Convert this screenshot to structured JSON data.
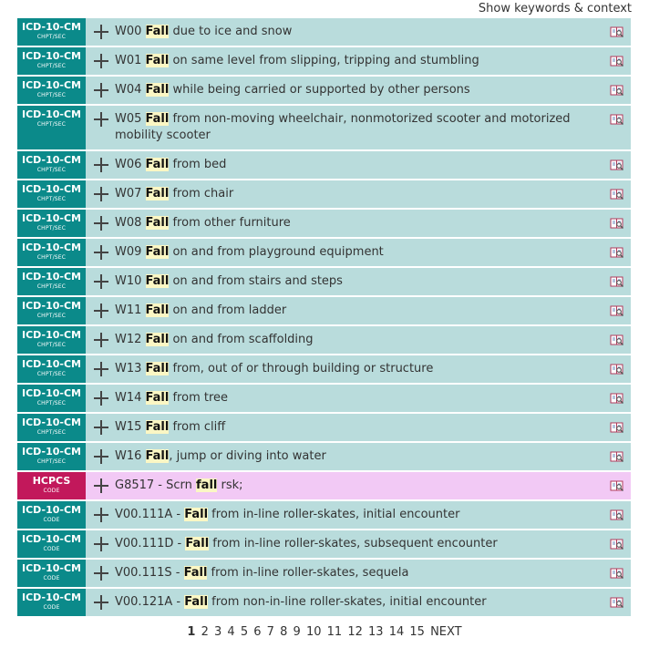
{
  "header": {
    "show_keywords_label": "Show keywords & context"
  },
  "rows": [
    {
      "type": "icd",
      "badge": "ICD-10-CM",
      "sub": "CHPT/SEC",
      "pre": "W00 ",
      "kw": "Fall",
      "post": " due to ice and snow"
    },
    {
      "type": "icd",
      "badge": "ICD-10-CM",
      "sub": "CHPT/SEC",
      "pre": "W01 ",
      "kw": "Fall",
      "post": " on same level from slipping, tripping and stumbling"
    },
    {
      "type": "icd",
      "badge": "ICD-10-CM",
      "sub": "CHPT/SEC",
      "pre": "W04 ",
      "kw": "Fall",
      "post": " while being carried or supported by other persons"
    },
    {
      "type": "icd",
      "badge": "ICD-10-CM",
      "sub": "CHPT/SEC",
      "pre": "W05 ",
      "kw": "Fall",
      "post": " from non-moving wheelchair, nonmotorized scooter and motorized mobility scooter"
    },
    {
      "type": "icd",
      "badge": "ICD-10-CM",
      "sub": "CHPT/SEC",
      "pre": "W06 ",
      "kw": "Fall",
      "post": " from bed"
    },
    {
      "type": "icd",
      "badge": "ICD-10-CM",
      "sub": "CHPT/SEC",
      "pre": "W07 ",
      "kw": "Fall",
      "post": " from chair"
    },
    {
      "type": "icd",
      "badge": "ICD-10-CM",
      "sub": "CHPT/SEC",
      "pre": "W08 ",
      "kw": "Fall",
      "post": " from other furniture"
    },
    {
      "type": "icd",
      "badge": "ICD-10-CM",
      "sub": "CHPT/SEC",
      "pre": "W09 ",
      "kw": "Fall",
      "post": " on and from playground equipment"
    },
    {
      "type": "icd",
      "badge": "ICD-10-CM",
      "sub": "CHPT/SEC",
      "pre": "W10 ",
      "kw": "Fall",
      "post": " on and from stairs and steps"
    },
    {
      "type": "icd",
      "badge": "ICD-10-CM",
      "sub": "CHPT/SEC",
      "pre": "W11 ",
      "kw": "Fall",
      "post": " on and from ladder"
    },
    {
      "type": "icd",
      "badge": "ICD-10-CM",
      "sub": "CHPT/SEC",
      "pre": "W12 ",
      "kw": "Fall",
      "post": " on and from scaffolding"
    },
    {
      "type": "icd",
      "badge": "ICD-10-CM",
      "sub": "CHPT/SEC",
      "pre": "W13 ",
      "kw": "Fall",
      "post": " from, out of or through building or structure"
    },
    {
      "type": "icd",
      "badge": "ICD-10-CM",
      "sub": "CHPT/SEC",
      "pre": "W14 ",
      "kw": "Fall",
      "post": " from tree"
    },
    {
      "type": "icd",
      "badge": "ICD-10-CM",
      "sub": "CHPT/SEC",
      "pre": "W15 ",
      "kw": "Fall",
      "post": " from cliff"
    },
    {
      "type": "icd",
      "badge": "ICD-10-CM",
      "sub": "CHPT/SEC",
      "pre": "W16 ",
      "kw": "Fall",
      "post": ", jump or diving into water"
    },
    {
      "type": "hcpcs",
      "badge": "HCPCS",
      "sub": "CODE",
      "pre": "G8517 - Scrn ",
      "kw": "fall",
      "post": " rsk;"
    },
    {
      "type": "icd",
      "badge": "ICD-10-CM",
      "sub": "CODE",
      "pre": "V00.111A - ",
      "kw": "Fall",
      "post": " from in-line roller-skates, initial encounter"
    },
    {
      "type": "icd",
      "badge": "ICD-10-CM",
      "sub": "CODE",
      "pre": "V00.111D - ",
      "kw": "Fall",
      "post": " from in-line roller-skates, subsequent encounter"
    },
    {
      "type": "icd",
      "badge": "ICD-10-CM",
      "sub": "CODE",
      "pre": "V00.111S - ",
      "kw": "Fall",
      "post": " from in-line roller-skates, sequela"
    },
    {
      "type": "icd",
      "badge": "ICD-10-CM",
      "sub": "CODE",
      "pre": "V00.121A - ",
      "kw": "Fall",
      "post": " from non-in-line roller-skates, initial encounter"
    }
  ],
  "pagination": {
    "current": "1",
    "pages": [
      "2",
      "3",
      "4",
      "5",
      "6",
      "7",
      "8",
      "9",
      "10",
      "11",
      "12",
      "13",
      "14",
      "15"
    ],
    "next_label": "NEXT"
  },
  "icons": {
    "expand": "plus-icon",
    "lookup": "book-lookup-icon"
  },
  "colors": {
    "icd_badge": "#0b8a8a",
    "icd_row": "#b9dcdc",
    "hcpcs_badge": "#c2185b",
    "hcpcs_row": "#f2c9f5",
    "keyword_highlight": "#fbf7c4"
  }
}
